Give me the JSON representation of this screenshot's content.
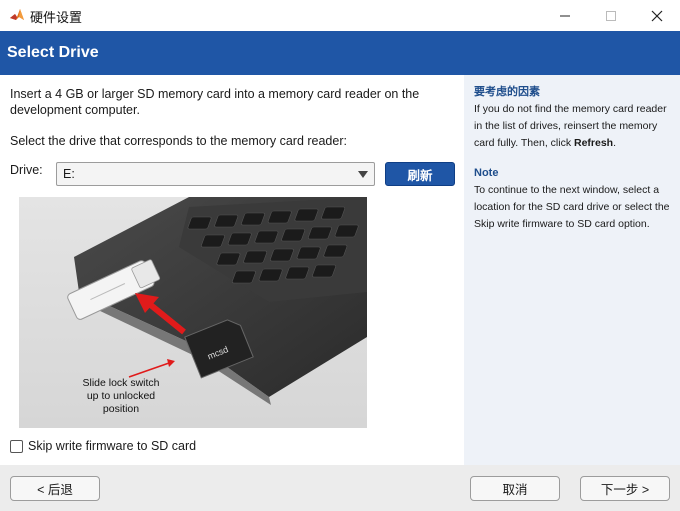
{
  "window": {
    "title": "硬件设置",
    "app_icon": "matlab-logo-icon",
    "controls": [
      "minimize-icon",
      "maximize-icon",
      "close-icon"
    ]
  },
  "header": {
    "title": "Select Drive"
  },
  "main": {
    "intro": "Insert a 4 GB or larger SD memory card into a memory card reader on the development computer.",
    "select_instruction": "Select the drive that corresponds to the memory card reader:",
    "drive_label": "Drive:",
    "drive_value": "E:",
    "refresh_label": "刷新",
    "photo_caption_line1": "Slide lock switch",
    "photo_caption_line2": "up to unlocked",
    "photo_caption_line3": "position",
    "skip_checkbox_label": "Skip write firmware to SD card",
    "skip_checked": false
  },
  "help": {
    "heading1": "要考虑的因素",
    "para1_prefix": "If you do not find the memory card reader in the list of drives, reinsert the memory card fully. Then, click ",
    "para1_bold": "Refresh",
    "para1_suffix": ".",
    "heading2": "Note",
    "para2": "To continue to the next window,  select a location for the SD card drive or select the Skip write firmware to SD card option."
  },
  "footer": {
    "back_label": "< 后退",
    "cancel_label": "取消",
    "next_label": "下一步 >"
  },
  "colors": {
    "header_bg": "#1f56a6",
    "help_bg": "#eef2f8",
    "help_heading": "#1f4e8c",
    "footer_bg": "#ececec"
  }
}
